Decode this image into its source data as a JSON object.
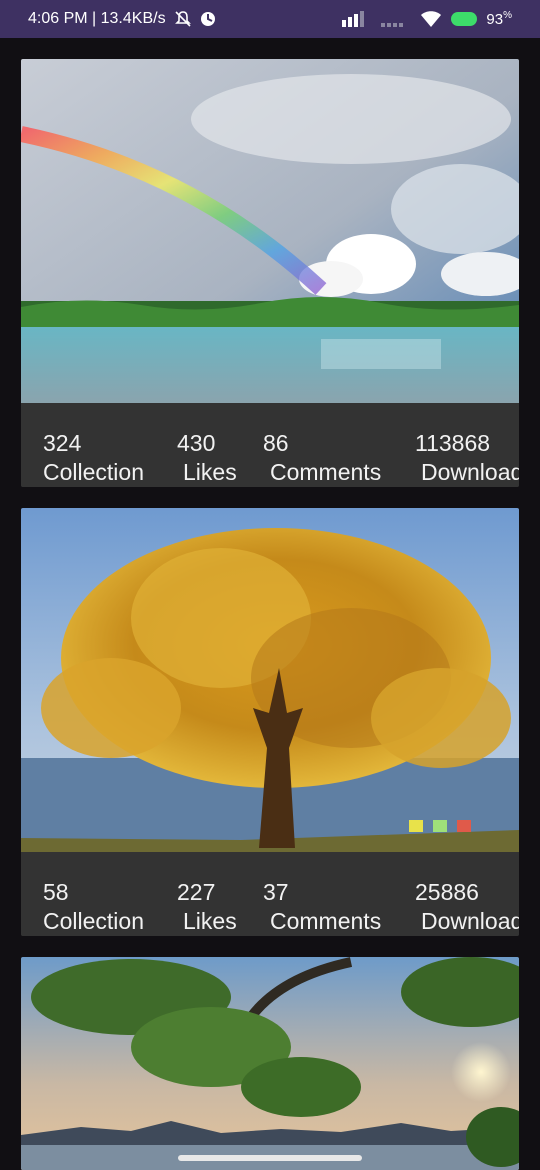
{
  "status_bar": {
    "time_speed": "4:06 PM | 13.4KB/s",
    "icons": [
      "mute-icon",
      "vpn-icon",
      "signal-icon",
      "signal-weak-icon",
      "wifi-icon",
      "battery-icon"
    ],
    "battery_percent": "93",
    "battery_unit": "%"
  },
  "cards": [
    {
      "image": "rainbow-lake-photo",
      "collection_count": "324",
      "collection_label": "Collection",
      "likes_count": "430",
      "likes_label": "Likes",
      "comments_count": "86",
      "comments_label": "Comments",
      "downloads_count": "113868",
      "downloads_label": "Downloads"
    },
    {
      "image": "golden-tree-photo",
      "collection_count": "58",
      "collection_label": "Collection",
      "likes_count": "227",
      "likes_label": "Likes",
      "comments_count": "37",
      "comments_label": "Comments",
      "downloads_count": "25886",
      "downloads_label": "Downloads"
    },
    {
      "image": "tree-canopy-sunset-photo"
    }
  ]
}
